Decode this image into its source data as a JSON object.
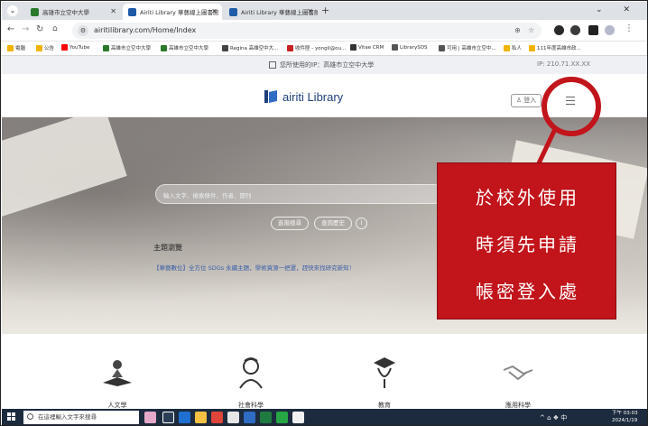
{
  "browser": {
    "tabs": [
      {
        "label": "高雄市立空中大學",
        "active": false
      },
      {
        "label": "Airiti Library 華藝線上圖書館",
        "active": true
      },
      {
        "label": "Airiti Library 華藝線上圖書館",
        "active": false
      }
    ],
    "new_tab": "+",
    "window_controls": "⌄ ✕",
    "url": "airitilibrary.com/Home/Index"
  },
  "bookmarks": [
    {
      "label": "電腦",
      "color": "#f0b400"
    },
    {
      "label": "公告",
      "color": "#f0b400"
    },
    {
      "label": "YouTube",
      "color": "#ff0000"
    },
    {
      "label": "高雄市立空中大學",
      "color": "#2b7a2b"
    },
    {
      "label": "高雄市立空中大學",
      "color": "#2b7a2b"
    },
    {
      "label": "Regina 高雄空中大...",
      "color": "#444444"
    },
    {
      "label": "收件匣 - yongli@ou...",
      "color": "#c5221f"
    },
    {
      "label": "Vitae CRM",
      "color": "#333333"
    },
    {
      "label": "LibrarySOS",
      "color": "#555555"
    },
    {
      "label": "可用 | 高雄市立空中...",
      "color": "#555555"
    },
    {
      "label": "私人",
      "color": "#f0b400"
    },
    {
      "label": "111年度高雄市政...",
      "color": "#f0b400"
    }
  ],
  "page": {
    "notice": "您所使用的IP：高雄市立空中大學",
    "ip_prefix": "IP: 210.71.XX.XX",
    "logo_text": "airiti Library",
    "login_label": "登入",
    "search_placeholder": "輸入文字、檢索條件、作者、期刊",
    "advanced_search": "進階搜尋",
    "search_history": "查詢歷史",
    "info_icon": "i",
    "topic_title": "主題瀏覽",
    "topic_link": "【華藝數位】全方位 SDGs 永續主題，學術資源一把罩，趕快來找研究新知！"
  },
  "annotation": {
    "lines": [
      "於校外使用",
      "時須先申請",
      "帳密登入處"
    ],
    "color": "#c2141b"
  },
  "categories": [
    {
      "label": "人文學",
      "icon": "book-reader-icon"
    },
    {
      "label": "社會科學",
      "icon": "scholar-icon"
    },
    {
      "label": "教育",
      "icon": "graduate-icon"
    },
    {
      "label": "應用科學",
      "icon": "handshake-icon"
    }
  ],
  "taskbar": {
    "search_placeholder": "在這裡輸入文字來搜尋",
    "tray": "^  ⌂ ❖ 中",
    "time": "下午 03:03",
    "date": "2024/1/19"
  }
}
